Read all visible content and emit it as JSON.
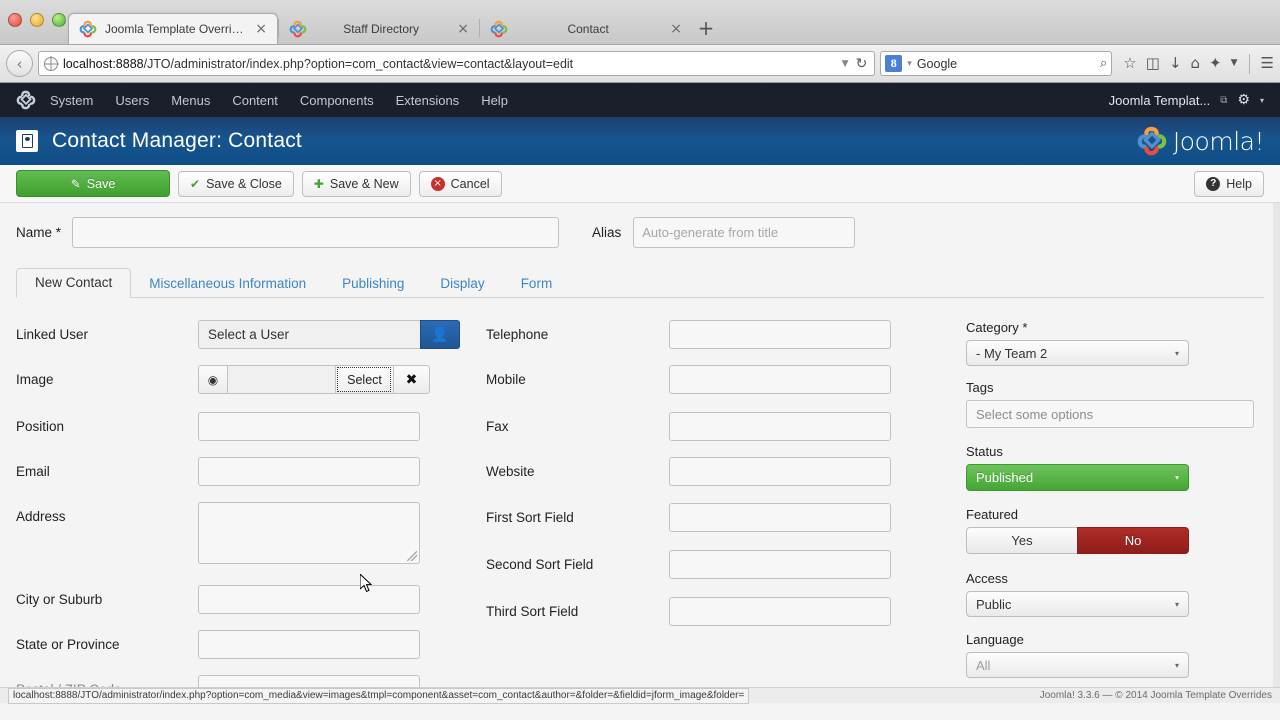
{
  "browser": {
    "tabs": [
      {
        "title": "Joomla Template Override...",
        "active": true,
        "icon": "joomla-icon",
        "close": "×"
      },
      {
        "title": "Staff Directory",
        "active": false,
        "icon": "joomla-icon",
        "close": "×"
      },
      {
        "title": "Contact",
        "active": false,
        "icon": "joomla-icon",
        "close": "×"
      }
    ],
    "new_tab_label": "+",
    "back_arrow": "‹",
    "url_host": "localhost:8888",
    "url_path": "/JTO/administrator/index.php?option=com_contact&view=contact&layout=edit",
    "url_dropdown": "▼",
    "reload": "↻",
    "search_engine": "8",
    "search_caret": "▾",
    "search_placeholder": "Google",
    "search_magnifier": "⌕",
    "toolbar_icons": [
      "bookmark-star-icon",
      "reader-list-icon",
      "downloads-icon",
      "home-icon",
      "sync-icon",
      "overflow-caret-icon",
      "hamburger-menu-icon"
    ]
  },
  "admin_menu": {
    "items": [
      "System",
      "Users",
      "Menus",
      "Content",
      "Components",
      "Extensions",
      "Help"
    ],
    "site_name": "Joomla Templat...",
    "external_icon": "⧉",
    "gear_icon": "⚙",
    "gear_caret": "▾"
  },
  "page_header": {
    "title": "Contact Manager: Contact",
    "brand": "Joomla!"
  },
  "toolbar": {
    "save_label": "Save",
    "save_close_label": "Save & Close",
    "save_new_label": "Save & New",
    "cancel_label": "Cancel",
    "help_label": "Help",
    "save_icon": "✎",
    "check_icon": "✔",
    "plus_icon": "✚",
    "cancel_icon": "×",
    "help_icon": "?"
  },
  "form": {
    "name_label": "Name *",
    "name_value": "",
    "alias_label": "Alias",
    "alias_placeholder": "Auto-generate from title",
    "tabs": [
      {
        "label": "New Contact",
        "active": true
      },
      {
        "label": "Miscellaneous Information",
        "active": false
      },
      {
        "label": "Publishing",
        "active": false
      },
      {
        "label": "Display",
        "active": false
      },
      {
        "label": "Form",
        "active": false
      }
    ],
    "left_column": {
      "linked_user": {
        "label": "Linked User",
        "value": "Select a User",
        "button_icon": "user-icon"
      },
      "image": {
        "label": "Image",
        "value": "",
        "eye_icon": "◉",
        "select_label": "Select",
        "clear_icon": "✖"
      },
      "fields": [
        {
          "label": "Position",
          "value": "",
          "type": "text"
        },
        {
          "label": "Email",
          "value": "",
          "type": "text"
        },
        {
          "label": "Address",
          "value": "",
          "type": "textarea"
        },
        {
          "label": "City or Suburb",
          "value": "",
          "type": "text"
        },
        {
          "label": "State or Province",
          "value": "",
          "type": "text"
        },
        {
          "label": "Postal / ZIP Code",
          "value": "",
          "type": "text"
        }
      ]
    },
    "mid_column": {
      "fields": [
        {
          "label": "Telephone",
          "value": ""
        },
        {
          "label": "Mobile",
          "value": ""
        },
        {
          "label": "Fax",
          "value": ""
        },
        {
          "label": "Website",
          "value": ""
        },
        {
          "label": "First Sort Field",
          "value": ""
        },
        {
          "label": "Second Sort Field",
          "value": ""
        },
        {
          "label": "Third Sort Field",
          "value": ""
        }
      ]
    },
    "right_column": {
      "category": {
        "label": "Category *",
        "value": "- My Team 2",
        "caret": "▾"
      },
      "tags": {
        "label": "Tags",
        "placeholder": "Select some options"
      },
      "status": {
        "label": "Status",
        "value": "Published",
        "caret": "▾"
      },
      "featured": {
        "label": "Featured",
        "yes_label": "Yes",
        "no_label": "No",
        "selected": "No"
      },
      "access": {
        "label": "Access",
        "value": "Public",
        "caret": "▾"
      },
      "language": {
        "label": "Language",
        "value": "All",
        "caret": "▾"
      }
    }
  },
  "statusbar": {
    "left": "localhost:8888/JTO/administrator/index.php?option=com_media&view=images&tmpl=component&asset=com_contact&author=&folder=&fieldid=jform_image&folder=",
    "right": "Joomla! 3.3.6 — © 2014 Joomla Template Overrides"
  },
  "colors": {
    "accent_blue": "#17558f",
    "save_green": "#45a634",
    "featured_red": "#8f1d1a",
    "link_blue": "#3d86c6"
  }
}
